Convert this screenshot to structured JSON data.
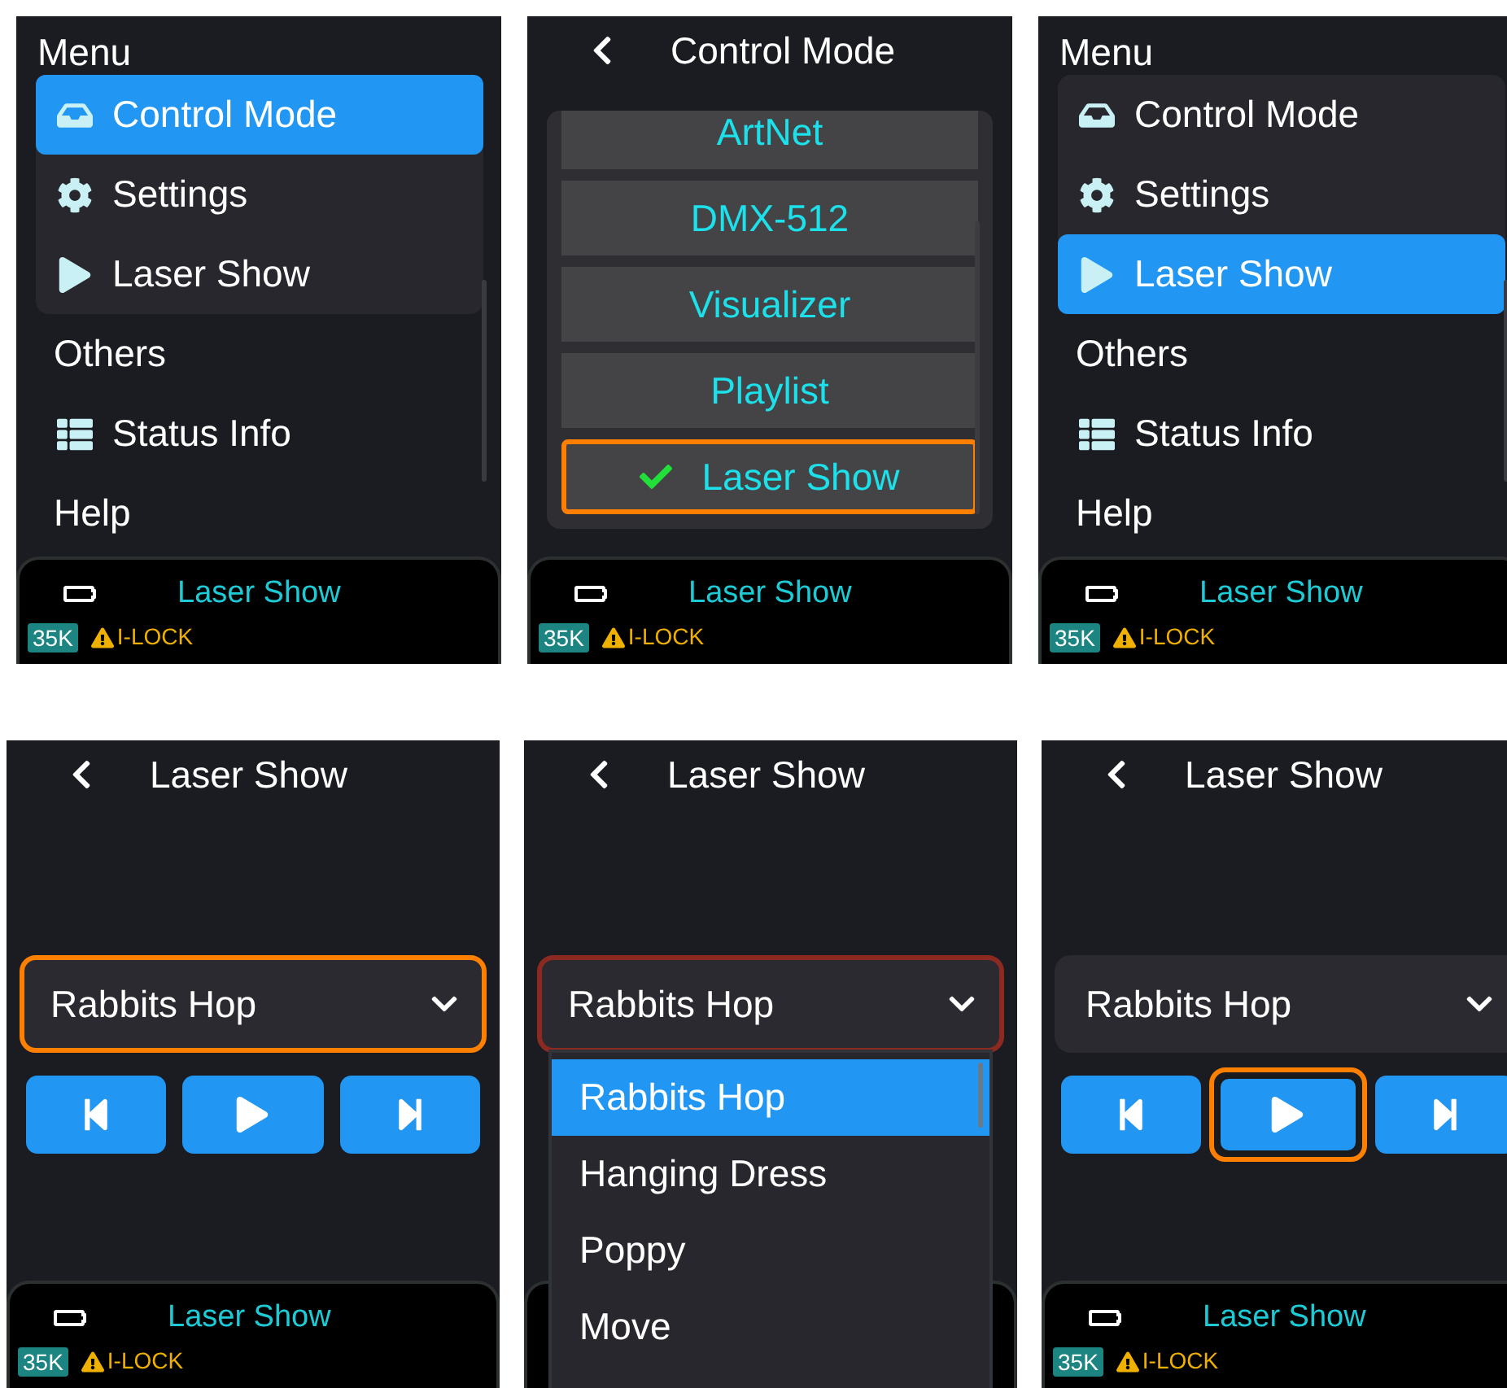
{
  "screens": [
    {
      "kind": "menu",
      "title": "Menu",
      "card_items": [
        {
          "label": "Control Mode",
          "selected": true
        },
        {
          "label": "Settings",
          "selected": false
        },
        {
          "label": "Laser Show",
          "selected": false
        }
      ],
      "items": [
        {
          "label": "Others",
          "selected": false
        },
        {
          "label": "Status Info",
          "selected": false
        },
        {
          "label": "Help",
          "selected": false
        }
      ],
      "status": {
        "mode": "Laser Show",
        "badge": "35K",
        "warning": "I-LOCK"
      }
    },
    {
      "kind": "mode_list",
      "title": "Control Mode",
      "options": [
        {
          "label": "ArtNet",
          "checked": false,
          "focused": false
        },
        {
          "label": "DMX-512",
          "checked": false,
          "focused": false
        },
        {
          "label": "Visualizer",
          "checked": false,
          "focused": false
        },
        {
          "label": "Playlist",
          "checked": false,
          "focused": false
        },
        {
          "label": "Laser Show",
          "checked": true,
          "focused": true
        }
      ],
      "status": {
        "mode": "Laser Show",
        "badge": "35K",
        "warning": "I-LOCK"
      }
    },
    {
      "kind": "menu",
      "title": "Menu",
      "card_items": [
        {
          "label": "Control Mode",
          "selected": false
        },
        {
          "label": "Settings",
          "selected": false
        },
        {
          "label": "Laser Show",
          "selected": true
        }
      ],
      "items": [
        {
          "label": "Others",
          "selected": false
        },
        {
          "label": "Status Info",
          "selected": false
        },
        {
          "label": "Help",
          "selected": false
        }
      ],
      "status": {
        "mode": "Laser Show",
        "badge": "35K",
        "warning": "I-LOCK"
      }
    },
    {
      "kind": "player",
      "title": "Laser Show",
      "dropdown": {
        "value": "Rabbits Hop",
        "focused": true,
        "open": false
      },
      "controls": [
        {
          "kind": "previous",
          "focused": false
        },
        {
          "kind": "play",
          "focused": false
        },
        {
          "kind": "next",
          "focused": false
        }
      ],
      "status": {
        "mode": "Laser Show",
        "badge": "35K",
        "warning": "I-LOCK"
      }
    },
    {
      "kind": "player",
      "title": "Laser Show",
      "dropdown": {
        "value": "Rabbits Hop",
        "focused": false,
        "open": true,
        "options": [
          {
            "label": "Rabbits Hop",
            "selected": true
          },
          {
            "label": "Hanging Dress",
            "selected": false
          },
          {
            "label": "Poppy",
            "selected": false
          },
          {
            "label": "Move",
            "selected": false
          }
        ]
      }
    },
    {
      "kind": "player",
      "title": "Laser Show",
      "dropdown": {
        "value": "Rabbits Hop",
        "focused": false,
        "open": false
      },
      "controls": [
        {
          "kind": "previous",
          "focused": false
        },
        {
          "kind": "play",
          "focused": true
        },
        {
          "kind": "next",
          "focused": false
        }
      ],
      "status": {
        "mode": "Laser Show",
        "badge": "35K",
        "warning": "I-LOCK"
      }
    }
  ]
}
